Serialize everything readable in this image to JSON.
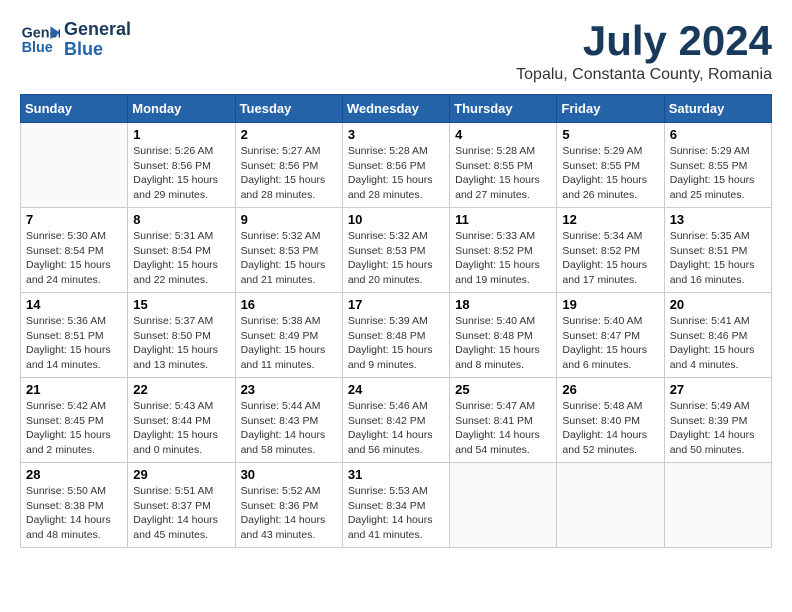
{
  "logo": {
    "line1": "General",
    "line2": "Blue"
  },
  "title": {
    "month_year": "July 2024",
    "location": "Topalu, Constanta County, Romania"
  },
  "days_of_week": [
    "Sunday",
    "Monday",
    "Tuesday",
    "Wednesday",
    "Thursday",
    "Friday",
    "Saturday"
  ],
  "weeks": [
    [
      {
        "day": "",
        "info": ""
      },
      {
        "day": "1",
        "info": "Sunrise: 5:26 AM\nSunset: 8:56 PM\nDaylight: 15 hours\nand 29 minutes."
      },
      {
        "day": "2",
        "info": "Sunrise: 5:27 AM\nSunset: 8:56 PM\nDaylight: 15 hours\nand 28 minutes."
      },
      {
        "day": "3",
        "info": "Sunrise: 5:28 AM\nSunset: 8:56 PM\nDaylight: 15 hours\nand 28 minutes."
      },
      {
        "day": "4",
        "info": "Sunrise: 5:28 AM\nSunset: 8:55 PM\nDaylight: 15 hours\nand 27 minutes."
      },
      {
        "day": "5",
        "info": "Sunrise: 5:29 AM\nSunset: 8:55 PM\nDaylight: 15 hours\nand 26 minutes."
      },
      {
        "day": "6",
        "info": "Sunrise: 5:29 AM\nSunset: 8:55 PM\nDaylight: 15 hours\nand 25 minutes."
      }
    ],
    [
      {
        "day": "7",
        "info": "Sunrise: 5:30 AM\nSunset: 8:54 PM\nDaylight: 15 hours\nand 24 minutes."
      },
      {
        "day": "8",
        "info": "Sunrise: 5:31 AM\nSunset: 8:54 PM\nDaylight: 15 hours\nand 22 minutes."
      },
      {
        "day": "9",
        "info": "Sunrise: 5:32 AM\nSunset: 8:53 PM\nDaylight: 15 hours\nand 21 minutes."
      },
      {
        "day": "10",
        "info": "Sunrise: 5:32 AM\nSunset: 8:53 PM\nDaylight: 15 hours\nand 20 minutes."
      },
      {
        "day": "11",
        "info": "Sunrise: 5:33 AM\nSunset: 8:52 PM\nDaylight: 15 hours\nand 19 minutes."
      },
      {
        "day": "12",
        "info": "Sunrise: 5:34 AM\nSunset: 8:52 PM\nDaylight: 15 hours\nand 17 minutes."
      },
      {
        "day": "13",
        "info": "Sunrise: 5:35 AM\nSunset: 8:51 PM\nDaylight: 15 hours\nand 16 minutes."
      }
    ],
    [
      {
        "day": "14",
        "info": "Sunrise: 5:36 AM\nSunset: 8:51 PM\nDaylight: 15 hours\nand 14 minutes."
      },
      {
        "day": "15",
        "info": "Sunrise: 5:37 AM\nSunset: 8:50 PM\nDaylight: 15 hours\nand 13 minutes."
      },
      {
        "day": "16",
        "info": "Sunrise: 5:38 AM\nSunset: 8:49 PM\nDaylight: 15 hours\nand 11 minutes."
      },
      {
        "day": "17",
        "info": "Sunrise: 5:39 AM\nSunset: 8:48 PM\nDaylight: 15 hours\nand 9 minutes."
      },
      {
        "day": "18",
        "info": "Sunrise: 5:40 AM\nSunset: 8:48 PM\nDaylight: 15 hours\nand 8 minutes."
      },
      {
        "day": "19",
        "info": "Sunrise: 5:40 AM\nSunset: 8:47 PM\nDaylight: 15 hours\nand 6 minutes."
      },
      {
        "day": "20",
        "info": "Sunrise: 5:41 AM\nSunset: 8:46 PM\nDaylight: 15 hours\nand 4 minutes."
      }
    ],
    [
      {
        "day": "21",
        "info": "Sunrise: 5:42 AM\nSunset: 8:45 PM\nDaylight: 15 hours\nand 2 minutes."
      },
      {
        "day": "22",
        "info": "Sunrise: 5:43 AM\nSunset: 8:44 PM\nDaylight: 15 hours\nand 0 minutes."
      },
      {
        "day": "23",
        "info": "Sunrise: 5:44 AM\nSunset: 8:43 PM\nDaylight: 14 hours\nand 58 minutes."
      },
      {
        "day": "24",
        "info": "Sunrise: 5:46 AM\nSunset: 8:42 PM\nDaylight: 14 hours\nand 56 minutes."
      },
      {
        "day": "25",
        "info": "Sunrise: 5:47 AM\nSunset: 8:41 PM\nDaylight: 14 hours\nand 54 minutes."
      },
      {
        "day": "26",
        "info": "Sunrise: 5:48 AM\nSunset: 8:40 PM\nDaylight: 14 hours\nand 52 minutes."
      },
      {
        "day": "27",
        "info": "Sunrise: 5:49 AM\nSunset: 8:39 PM\nDaylight: 14 hours\nand 50 minutes."
      }
    ],
    [
      {
        "day": "28",
        "info": "Sunrise: 5:50 AM\nSunset: 8:38 PM\nDaylight: 14 hours\nand 48 minutes."
      },
      {
        "day": "29",
        "info": "Sunrise: 5:51 AM\nSunset: 8:37 PM\nDaylight: 14 hours\nand 45 minutes."
      },
      {
        "day": "30",
        "info": "Sunrise: 5:52 AM\nSunset: 8:36 PM\nDaylight: 14 hours\nand 43 minutes."
      },
      {
        "day": "31",
        "info": "Sunrise: 5:53 AM\nSunset: 8:34 PM\nDaylight: 14 hours\nand 41 minutes."
      },
      {
        "day": "",
        "info": ""
      },
      {
        "day": "",
        "info": ""
      },
      {
        "day": "",
        "info": ""
      }
    ]
  ]
}
